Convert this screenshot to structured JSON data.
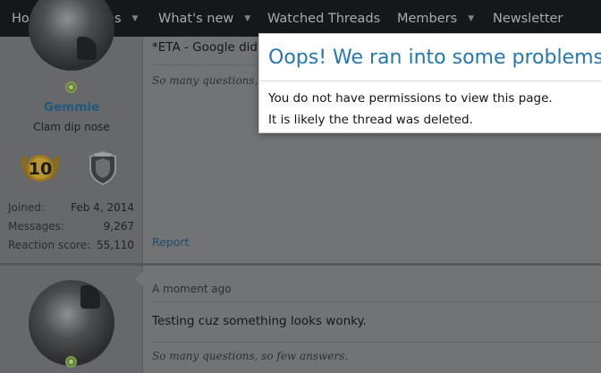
{
  "nav": {
    "items": [
      {
        "label": "Home"
      },
      {
        "label": "Forums"
      },
      {
        "label": "What's new"
      },
      {
        "label": "Watched Threads"
      },
      {
        "label": "Members"
      },
      {
        "label": "Newsletter"
      }
    ]
  },
  "post1": {
    "user": {
      "name": "Gemmie",
      "title": "Clam dip nose",
      "trophy_points": "10"
    },
    "stats": [
      {
        "label": "Joined:",
        "value": "Feb 4, 2014"
      },
      {
        "label": "Messages:",
        "value": "9,267"
      },
      {
        "label": "Reaction score:",
        "value": "55,110"
      }
    ],
    "body_text": "*ETA - Google didn",
    "signature": "So many questions,",
    "report_label": "Report"
  },
  "post2": {
    "timestamp": "A moment ago",
    "body_text": "Testing cuz something looks wonky.",
    "signature": "So many questions, so few answers."
  },
  "dialog": {
    "title": "Oops! We ran into some problems.",
    "lines": [
      "You do not have permissions to view this page.",
      "It is likely the thread was deleted."
    ]
  },
  "colors": {
    "nav_bg": "#14181b",
    "dialog_title": "#2577b1",
    "username": "#215a7a"
  }
}
